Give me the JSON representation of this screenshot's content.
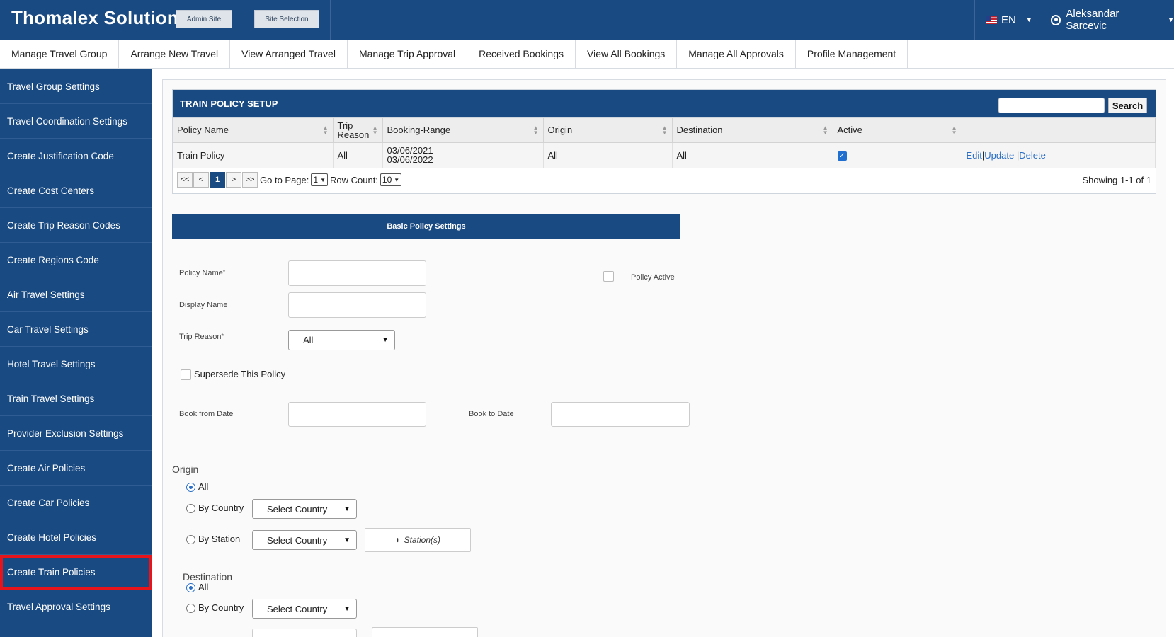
{
  "header": {
    "brand": "Thomalex Solution",
    "admin_site_label": "Admin Site",
    "site_selection_label": "Site Selection",
    "language": "EN",
    "user_name": "Aleksandar Sarcevic"
  },
  "nav": {
    "items": [
      "Manage Travel Group",
      "Arrange New Travel",
      "View Arranged Travel",
      "Manage Trip Approval",
      "Received Bookings",
      "View All Bookings",
      "Manage All Approvals",
      "Profile Management"
    ]
  },
  "sidebar": {
    "items": [
      "Travel Group Settings",
      "Travel Coordination Settings",
      "Create Justification Code",
      "Create Cost Centers",
      "Create Trip Reason Codes",
      "Create Regions Code",
      "Air Travel Settings",
      "Car Travel Settings",
      "Hotel Travel Settings",
      "Train Travel Settings",
      "Provider Exclusion Settings",
      "Create Air Policies",
      "Create Car Policies",
      "Create Hotel Policies",
      "Create Train Policies",
      "Travel Approval Settings"
    ],
    "active_item": "Create Train Policies",
    "active_color": "#e8141c"
  },
  "table": {
    "title": "TRAIN POLICY SETUP",
    "search_label": "Search",
    "columns": {
      "policy_name": "Policy Name",
      "trip_reason_1": "Trip",
      "trip_reason_2": "Reason",
      "booking_range": "Booking-Range",
      "origin": "Origin",
      "destination": "Destination",
      "active": "Active"
    },
    "row": {
      "policy_name": "Train Policy",
      "trip_reason": "All",
      "range_start": "03/06/2021",
      "range_end": "03/06/2022",
      "origin": "All",
      "destination": "All",
      "active": true,
      "edit": "Edit",
      "update": "Update",
      "delete": "Delete"
    },
    "pager": {
      "first": "<<",
      "prev": "<",
      "current": "1",
      "next": ">",
      "last": ">>",
      "goto_label": "Go to Page:",
      "goto_value": "1",
      "rowcount_label": "Row Count:",
      "rowcount_value": "10",
      "showing": "Showing 1-1 of 1"
    }
  },
  "form": {
    "section_title": "Basic Policy Settings",
    "policy_name_label": "Policy Name",
    "display_name_label": "Display Name",
    "trip_reason_label": "Trip Reason",
    "trip_reason_value": "All",
    "policy_active_label": "Policy Active",
    "supersede_label": "Supersede This Policy",
    "book_from_label": "Book from Date",
    "book_to_label": "Book to Date",
    "required_mark": "*"
  },
  "origin": {
    "heading": "Origin",
    "all_label": "All",
    "by_country_label": "By Country",
    "by_station_label": "By Station",
    "country_select": "Select Country",
    "station_label": "Station(s)",
    "selected": "All"
  },
  "destination": {
    "heading": "Destination",
    "all_label": "All",
    "by_country_label": "By Country",
    "country_select": "Select Country",
    "selected": "All"
  },
  "colors": {
    "primary": "#1a4a82",
    "link": "#2a6fc7",
    "highlight": "#e8141c"
  }
}
